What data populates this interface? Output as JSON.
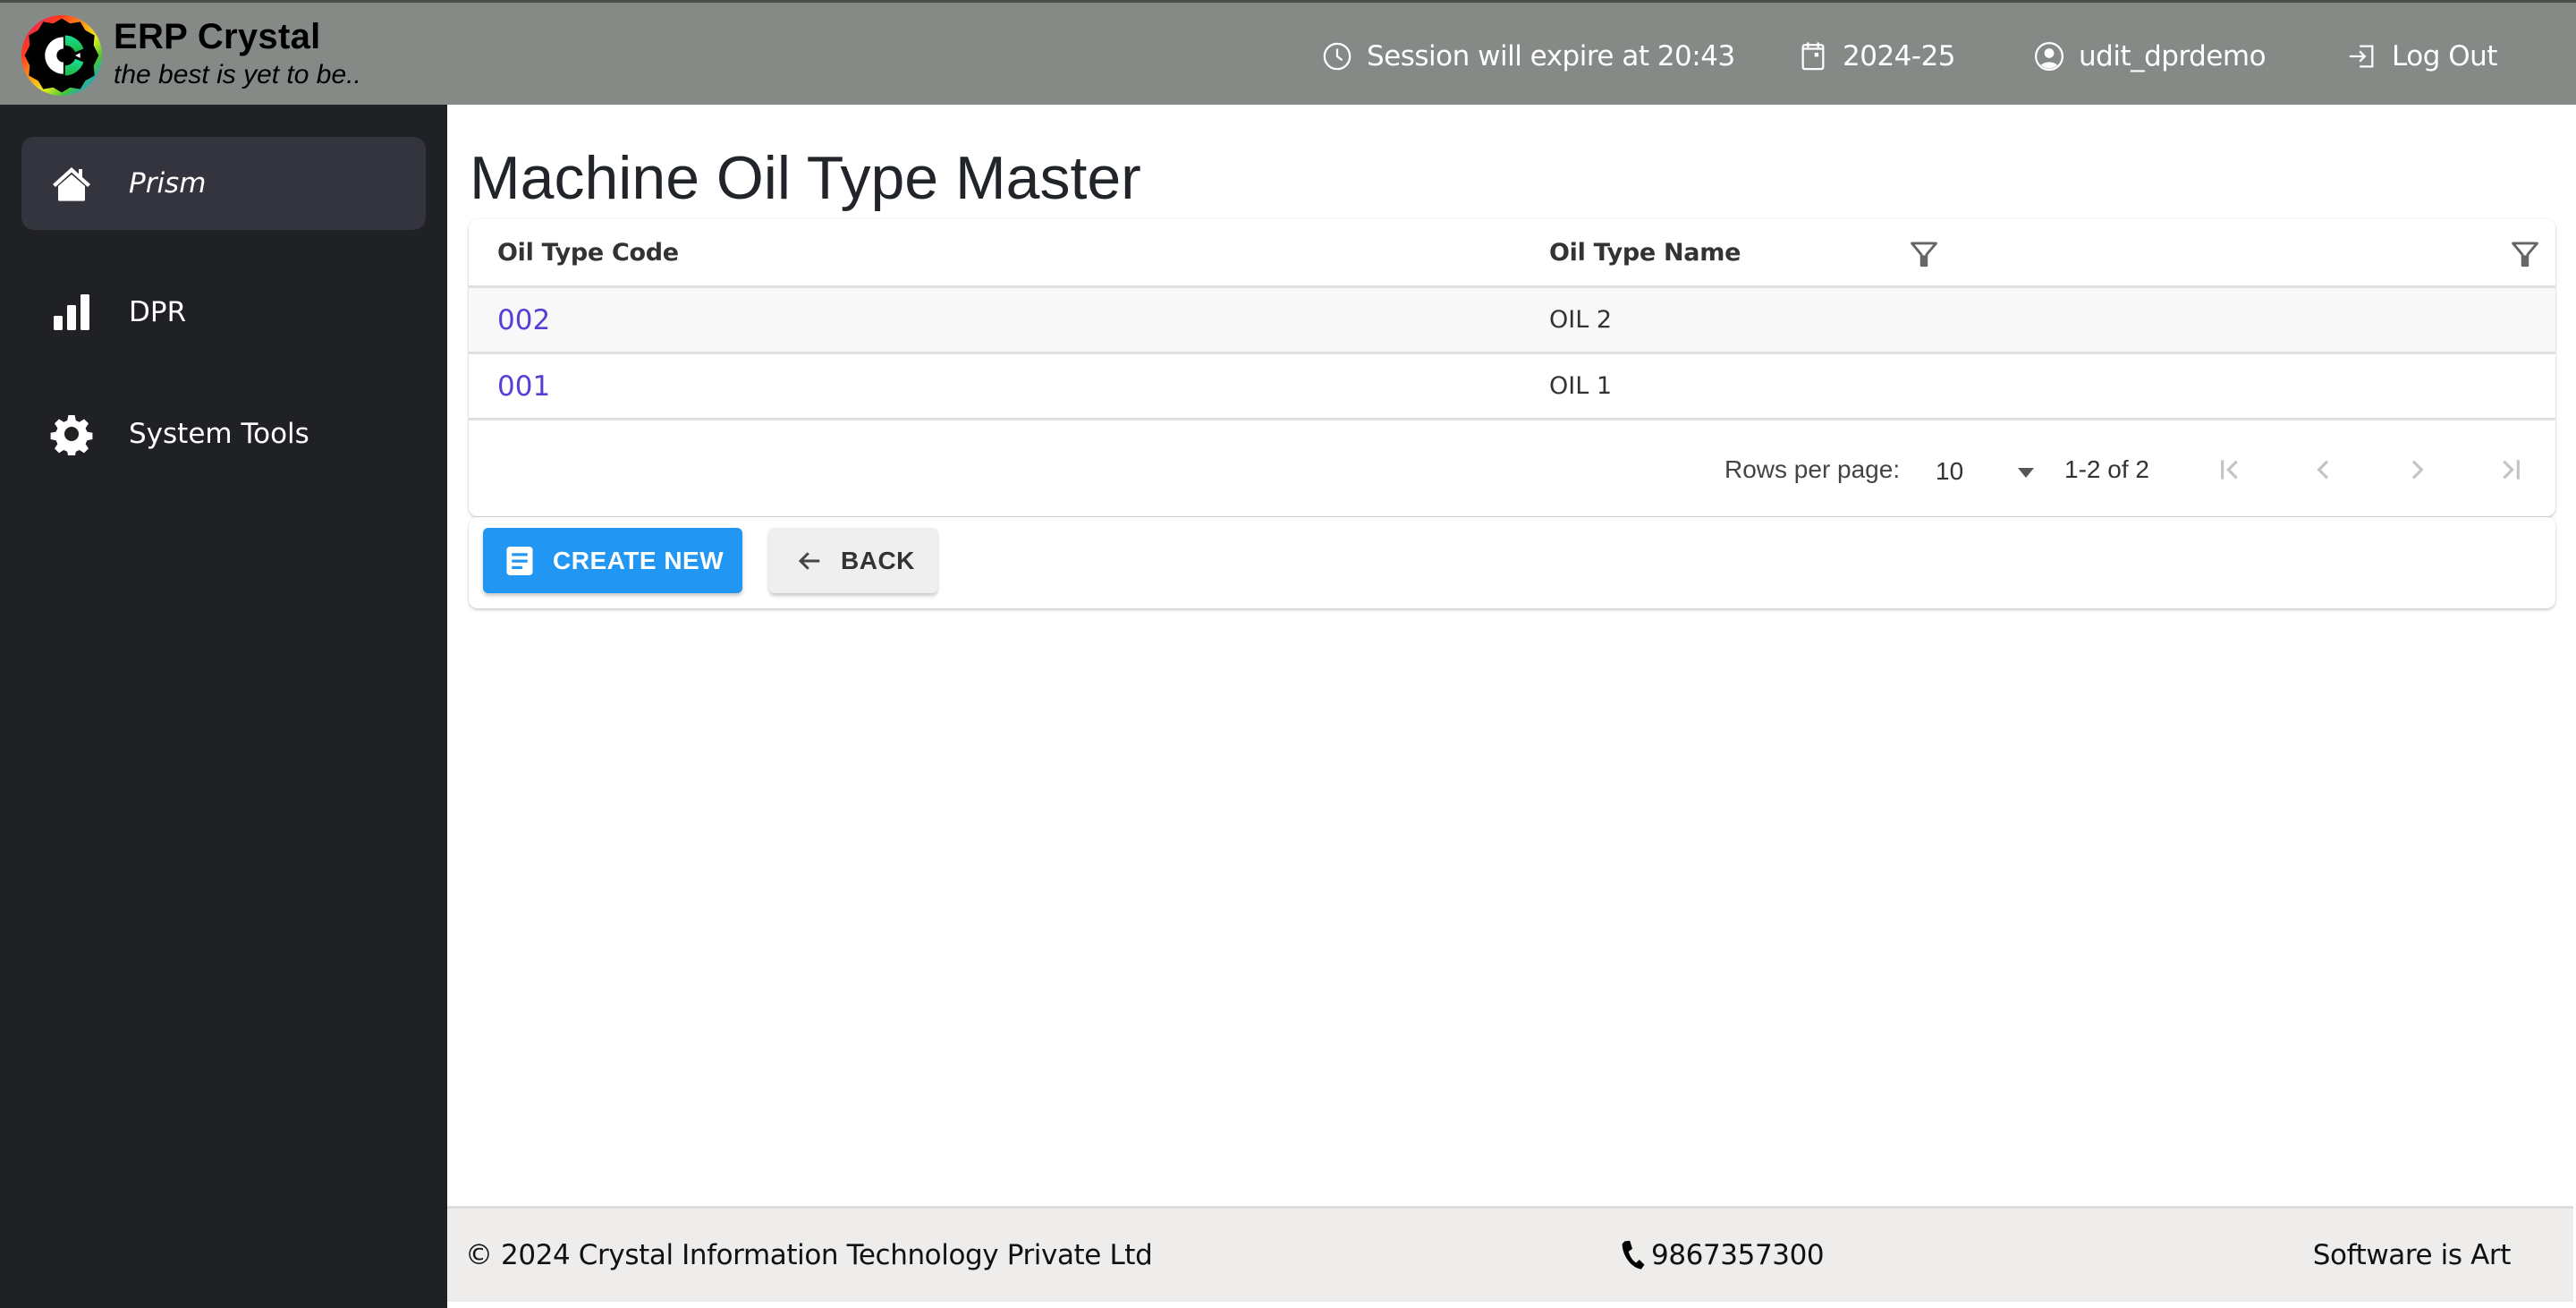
{
  "header": {
    "brand_title": "ERP Crystal",
    "brand_tagline": "the best is yet to be..",
    "session_text": "Session will expire at 20:43",
    "session_icon": "clock-icon",
    "financial_year": "2024-25",
    "year_icon": "calendar-icon",
    "username": "udit_dprdemo",
    "user_icon": "user-circle-icon",
    "logout_label": "Log Out",
    "logout_icon": "logout-icon"
  },
  "sidebar": {
    "items": [
      {
        "label": "Prism",
        "icon": "home-icon",
        "active": true
      },
      {
        "label": "DPR",
        "icon": "bar-chart-icon",
        "active": false
      },
      {
        "label": "System Tools",
        "icon": "gear-icon",
        "active": false
      }
    ]
  },
  "main": {
    "title": "Machine Oil Type Master",
    "table": {
      "columns": [
        {
          "label": "Oil Type Code",
          "filter_icon": "filter-icon"
        },
        {
          "label": "Oil Type Name",
          "filter_icon": "filter-icon"
        }
      ],
      "rows": [
        {
          "code": "002",
          "name": "OIL 2"
        },
        {
          "code": "001",
          "name": "OIL 1"
        }
      ]
    },
    "pagination": {
      "rows_per_page_label": "Rows per page:",
      "rows_per_page_value": "10",
      "range_text": "1-2 of 2"
    },
    "buttons": {
      "create_label": "CREATE NEW",
      "back_label": "BACK"
    }
  },
  "footer": {
    "copyright": "© 2024 Crystal Information Technology Private Ltd",
    "phone": "9867357300",
    "motto": "Software is Art"
  },
  "colors": {
    "header_bg": "#858a86",
    "sidebar_bg": "#202124",
    "sidebar_active_bg": "#34343f",
    "link": "#5540d6",
    "primary_button": "#2196f3",
    "footer_bg": "#efedec"
  }
}
